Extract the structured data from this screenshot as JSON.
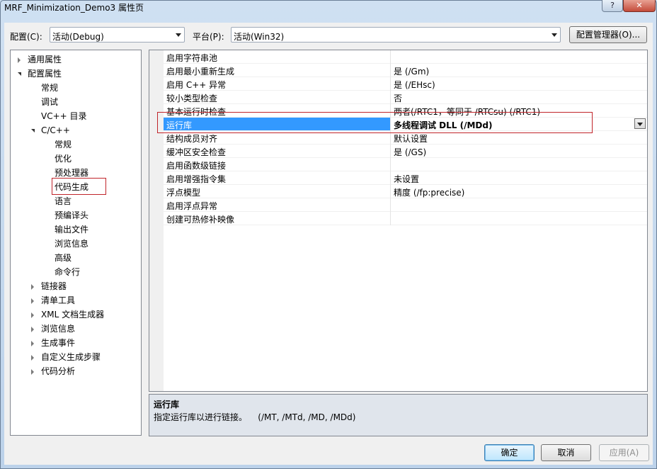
{
  "window": {
    "title": "MRF_Minimization_Demo3 属性页",
    "help_label": "?",
    "close_label": "✕"
  },
  "config_bar": {
    "config_label": "配置(C):",
    "config_value": "活动(Debug)",
    "platform_label": "平台(P):",
    "platform_value": "活动(Win32)",
    "manager_label": "配置管理器(O)..."
  },
  "tree": {
    "items": [
      {
        "label": "通用属性",
        "expander": "collapsed",
        "level": 0
      },
      {
        "label": "配置属性",
        "expander": "expanded",
        "level": 0
      },
      {
        "label": "常规",
        "expander": "none",
        "level": 1
      },
      {
        "label": "调试",
        "expander": "none",
        "level": 1
      },
      {
        "label": "VC++ 目录",
        "expander": "none",
        "level": 1
      },
      {
        "label": "C/C++",
        "expander": "expanded",
        "level": 1
      },
      {
        "label": "常规",
        "expander": "none",
        "level": 2
      },
      {
        "label": "优化",
        "expander": "none",
        "level": 2
      },
      {
        "label": "预处理器",
        "expander": "none",
        "level": 2
      },
      {
        "label": "代码生成",
        "expander": "none",
        "level": 2,
        "highlighted": true
      },
      {
        "label": "语言",
        "expander": "none",
        "level": 2
      },
      {
        "label": "预编译头",
        "expander": "none",
        "level": 2
      },
      {
        "label": "输出文件",
        "expander": "none",
        "level": 2
      },
      {
        "label": "浏览信息",
        "expander": "none",
        "level": 2
      },
      {
        "label": "高级",
        "expander": "none",
        "level": 2
      },
      {
        "label": "命令行",
        "expander": "none",
        "level": 2
      },
      {
        "label": "链接器",
        "expander": "collapsed",
        "level": 1
      },
      {
        "label": "清单工具",
        "expander": "collapsed",
        "level": 1
      },
      {
        "label": "XML 文档生成器",
        "expander": "collapsed",
        "level": 1
      },
      {
        "label": "浏览信息",
        "expander": "collapsed",
        "level": 1
      },
      {
        "label": "生成事件",
        "expander": "collapsed",
        "level": 1
      },
      {
        "label": "自定义生成步骤",
        "expander": "collapsed",
        "level": 1
      },
      {
        "label": "代码分析",
        "expander": "collapsed",
        "level": 1
      }
    ]
  },
  "grid": {
    "rows": [
      {
        "name": "启用字符串池",
        "value": ""
      },
      {
        "name": "启用最小重新生成",
        "value": "是 (/Gm)"
      },
      {
        "name": "启用 C++ 异常",
        "value": "是 (/EHsc)"
      },
      {
        "name": "较小类型检查",
        "value": "否"
      },
      {
        "name": "基本运行时检查",
        "value": "两者(/RTC1，等同于 /RTCsu) (/RTC1)"
      },
      {
        "name": "运行库",
        "value": "多线程调试 DLL (/MDd)",
        "selected": true
      },
      {
        "name": "结构成员对齐",
        "value": "默认设置"
      },
      {
        "name": "缓冲区安全检查",
        "value": "是 (/GS)"
      },
      {
        "name": "启用函数级链接",
        "value": ""
      },
      {
        "name": "启用增强指令集",
        "value": "未设置"
      },
      {
        "name": "浮点模型",
        "value": "精度 (/fp:precise)"
      },
      {
        "name": "启用浮点异常",
        "value": ""
      },
      {
        "name": "创建可热修补映像",
        "value": ""
      }
    ]
  },
  "description": {
    "title": "运行库",
    "text": "指定运行库以进行链接。    (/MT, /MTd, /MD, /MDd)"
  },
  "buttons": {
    "ok": "确定",
    "cancel": "取消",
    "apply": "应用(A)"
  },
  "colors": {
    "selection": "#3399ff",
    "annotation": "#c0242a",
    "desc_bg": "#e0e5ec"
  }
}
